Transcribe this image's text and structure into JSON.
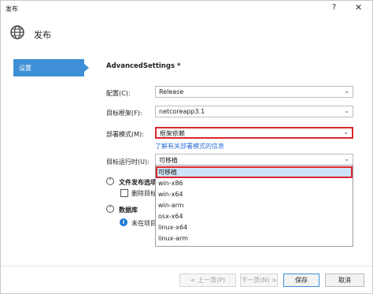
{
  "window": {
    "title": "发布",
    "help_glyph": "?",
    "close_glyph": "✕"
  },
  "header": {
    "title": "发布"
  },
  "sidebar": {
    "items": [
      {
        "label": "设置"
      }
    ]
  },
  "main": {
    "heading": "AdvancedSettings *",
    "fields": {
      "configuration": {
        "label": "配置(C):",
        "value": "Release"
      },
      "target_framework": {
        "label": "目标框架(F):",
        "value": "netcoreapp3.1"
      },
      "deployment_mode": {
        "label": "部署模式(M):",
        "value": "框架依赖"
      },
      "deployment_link": "了解有关部署模式的信息",
      "target_runtime": {
        "label": "目标运行时(U):",
        "value": "可移植"
      }
    },
    "runtime_options": [
      "可移植",
      "win-x86",
      "win-x64",
      "win-arm",
      "osx-x64",
      "linux-x64",
      "linux-arm"
    ],
    "file_publish_section": {
      "title": "文件发布选项",
      "checkbox_label": "删除目标"
    },
    "database_section": {
      "title": "数据库",
      "info_text": "未在项目"
    }
  },
  "footer": {
    "prev": "< 上一页(P)",
    "next": "下一页(N) >",
    "save": "保存",
    "cancel": "取消"
  },
  "colors": {
    "accent": "#3e8fd6",
    "highlight_border": "#d9272e",
    "link": "#2e6fd1"
  }
}
